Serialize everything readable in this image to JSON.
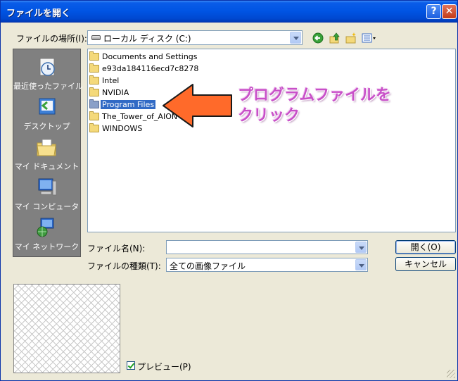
{
  "window": {
    "title": "ファイルを開く",
    "help_label": "?",
    "close_label": "✕"
  },
  "toolbar": {
    "lookin_label": "ファイルの場所(I):",
    "lookin_value": "ローカル ディスク (C:)",
    "icons": [
      "back-icon",
      "up-folder-icon",
      "new-folder-icon",
      "view-menu-icon"
    ]
  },
  "places": [
    {
      "label": "最近使ったファイル",
      "icon": "recent-files-icon"
    },
    {
      "label": "デスクトップ",
      "icon": "desktop-icon"
    },
    {
      "label": "マイ ドキュメント",
      "icon": "my-documents-icon"
    },
    {
      "label": "マイ コンピュータ",
      "icon": "my-computer-icon"
    },
    {
      "label": "マイ ネットワーク",
      "icon": "my-network-icon"
    }
  ],
  "files": [
    {
      "name": "Documents and Settings",
      "selected": false
    },
    {
      "name": "e93da184116ecd7c8278",
      "selected": false
    },
    {
      "name": "Intel",
      "selected": false
    },
    {
      "name": "NVIDIA",
      "selected": false
    },
    {
      "name": "Program Files",
      "selected": true
    },
    {
      "name": "The_Tower_of_AION",
      "selected": false
    },
    {
      "name": "WINDOWS",
      "selected": false
    }
  ],
  "annotation": {
    "line1": "プログラムファイルを",
    "line2": "クリック",
    "color": "#c850c8",
    "arrow_color": "#ff6a2a"
  },
  "filename": {
    "label": "ファイル名(N):",
    "value": ""
  },
  "filetype": {
    "label": "ファイルの種類(T):",
    "value": "全ての画像ファイル"
  },
  "buttons": {
    "open": "開く(O)",
    "cancel": "キャンセル"
  },
  "preview": {
    "label": "プレビュー(P)",
    "checked": true
  }
}
